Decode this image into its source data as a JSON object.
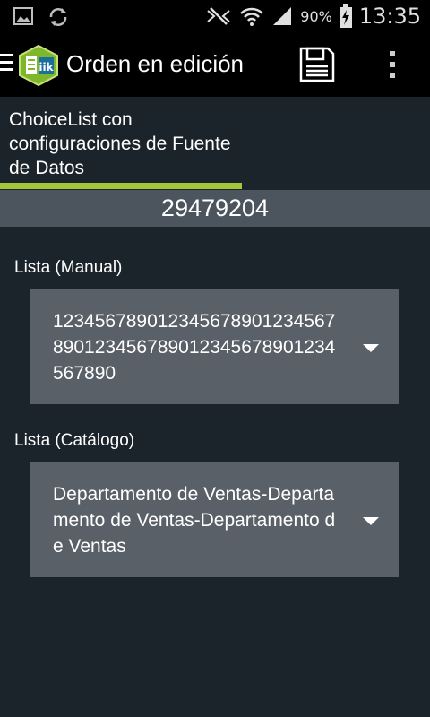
{
  "status_bar": {
    "battery_percent": "90%",
    "time": "13:35",
    "icons": [
      "image-icon",
      "sync-icon",
      "mute-icon",
      "wifi-icon",
      "signal-icon",
      "battery-charging-icon"
    ]
  },
  "action_bar": {
    "title": "Orden en edición",
    "icons": [
      "menu-icon",
      "app-logo-icon",
      "save-icon",
      "overflow-menu-icon"
    ]
  },
  "section": {
    "title": "ChoiceList con configuraciones de Fuente de Datos",
    "accent_color": "#a4c63a"
  },
  "record_id": "29479204",
  "fields": {
    "manual": {
      "label": "Lista (Manual)",
      "value": "123456789012345678901234567890123456789012345678901234567890"
    },
    "catalog": {
      "label": "Lista (Catálogo)",
      "value": "Departamento de Ventas-Departamento de Ventas-Departamento de Ventas"
    }
  }
}
